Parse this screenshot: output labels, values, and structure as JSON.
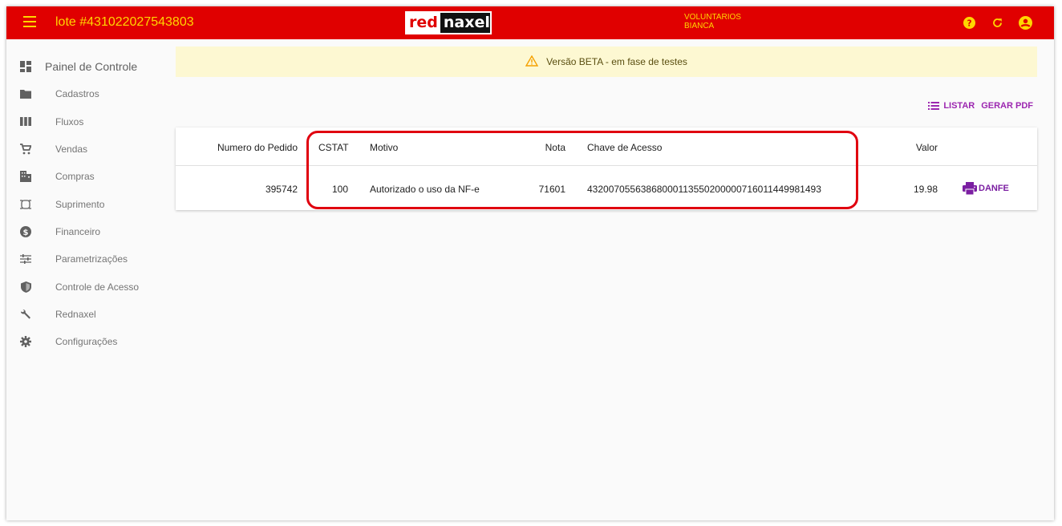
{
  "header": {
    "lote": "lote #431022027543803",
    "logo_left": "red",
    "logo_right": "naxel",
    "user_line1": "VOLUNTARIOS",
    "user_line2": "BIANCA",
    "accent": "#e00000",
    "text_color": "#ffd600",
    "icons": [
      "help-icon",
      "refresh-icon",
      "account-icon"
    ]
  },
  "sidebar": {
    "items": [
      {
        "label": "Painel de Controle",
        "icon": "dashboard-icon"
      },
      {
        "label": "Cadastros",
        "icon": "folder-icon"
      },
      {
        "label": "Fluxos",
        "icon": "columns-icon"
      },
      {
        "label": "Vendas",
        "icon": "cart-icon"
      },
      {
        "label": "Compras",
        "icon": "store-icon"
      },
      {
        "label": "Suprimento",
        "icon": "crop-icon"
      },
      {
        "label": "Financeiro",
        "icon": "dollar-icon"
      },
      {
        "label": "Parametrizações",
        "icon": "sliders-icon"
      },
      {
        "label": "Controle de Acesso",
        "icon": "shield-icon"
      },
      {
        "label": "Rednaxel",
        "icon": "wrench-icon"
      },
      {
        "label": "Configurações",
        "icon": "gear-icon"
      }
    ]
  },
  "banner": {
    "text": "Versão BETA - em fase de testes",
    "icon": "warning-icon"
  },
  "actions": {
    "listar": "LISTAR",
    "gerar_pdf": "GERAR PDF"
  },
  "table": {
    "headers": {
      "pedido": "Numero do Pedido",
      "cstat": "CSTAT",
      "motivo": "Motivo",
      "nota": "Nota",
      "chave": "Chave de Acesso",
      "valor": "Valor"
    },
    "row": {
      "pedido": "395742",
      "cstat": "100",
      "motivo": "Autorizado o uso da NF-e",
      "nota": "71601",
      "chave": "43200705563868000113550200000716011449981493",
      "valor": "19.98",
      "danfe": "DANFE"
    }
  }
}
